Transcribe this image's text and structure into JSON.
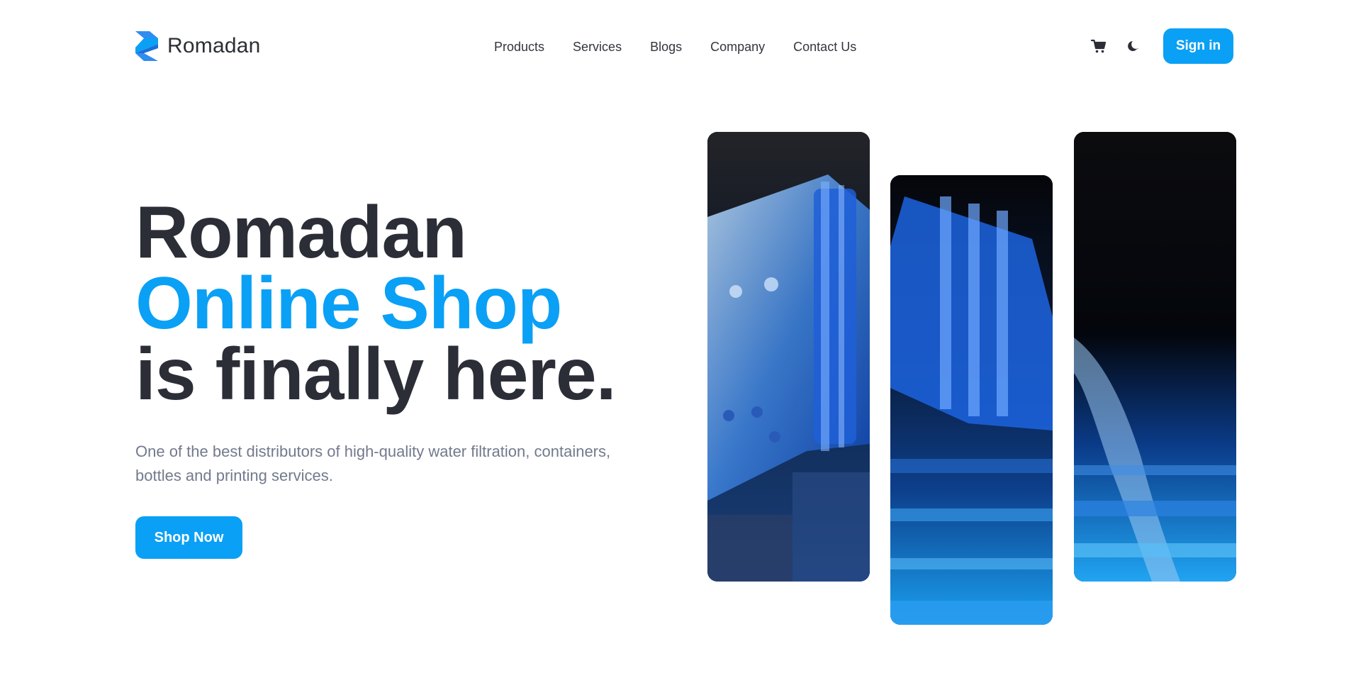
{
  "brand": {
    "name": "Romadan",
    "logo_icon": "romadan-logo-icon",
    "accent_color": "#0aa0f5",
    "text_color": "#2b2e36"
  },
  "nav": {
    "items": [
      {
        "label": "Products"
      },
      {
        "label": "Services"
      },
      {
        "label": "Blogs"
      },
      {
        "label": "Company"
      },
      {
        "label": "Contact Us"
      }
    ]
  },
  "header_actions": {
    "cart_icon": "cart-icon",
    "theme_icon": "moon-icon",
    "signin_label": "Sign in"
  },
  "hero": {
    "title_line1": "Romadan",
    "title_line2": "Online Shop",
    "title_line3": "is finally here.",
    "description": "One of the best distributors of high-quality water filtration, containers, bottles and printing services.",
    "cta_label": "Shop Now"
  },
  "gallery": {
    "panels": [
      {
        "subject": "water-bottle-pouring-image"
      },
      {
        "subject": "bottle-neck-closeup-image"
      },
      {
        "subject": "water-stream-glass-image"
      }
    ]
  }
}
